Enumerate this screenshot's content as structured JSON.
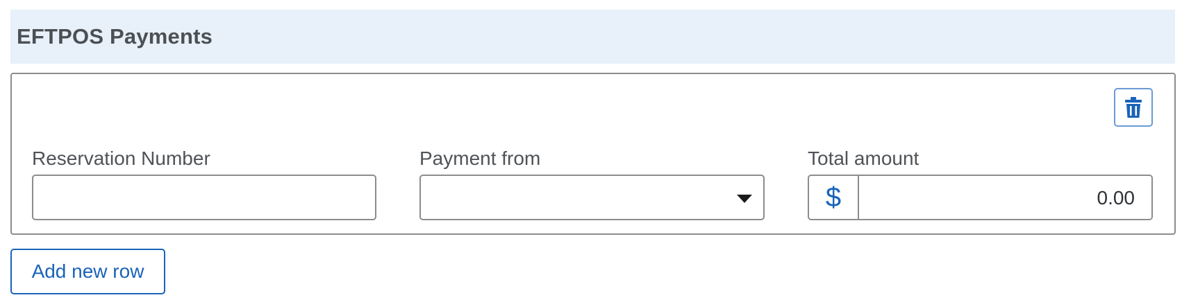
{
  "section": {
    "title": "EFTPOS Payments"
  },
  "row": {
    "delete_icon": "trash-icon",
    "reservation": {
      "label": "Reservation Number",
      "value": "",
      "placeholder": ""
    },
    "payment_from": {
      "label": "Payment from",
      "selected": ""
    },
    "total_amount": {
      "label": "Total amount",
      "currency_symbol": "$",
      "value": "0.00"
    }
  },
  "actions": {
    "add_row_label": "Add new row"
  },
  "colors": {
    "header_bg": "#e8f0fa",
    "accent": "#1a63b8",
    "border": "#8c8c8c",
    "delete_border": "#6a9ad6"
  }
}
